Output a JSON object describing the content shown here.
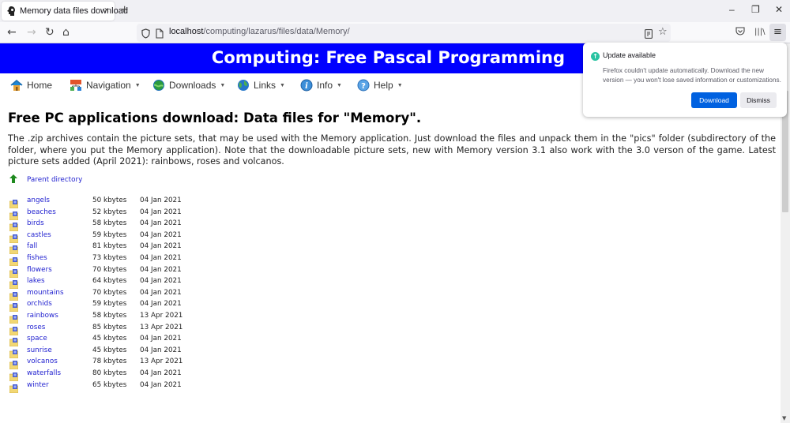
{
  "browser": {
    "tab": {
      "title": "Memory data files download",
      "close": "×"
    },
    "new_tab": "+",
    "window_controls": {
      "minimize": "–",
      "restore": "❐",
      "close": "✕"
    },
    "nav": {
      "back": "←",
      "forward": "→",
      "reload": "↻",
      "home": "⌂"
    },
    "url": {
      "host": "localhost",
      "path": "/computing/lazarus/files/data/Memory/"
    },
    "toolbar": {
      "bookmark": "☆",
      "pocket": "◡",
      "library": "|||\\",
      "menu": "≡"
    }
  },
  "page": {
    "banner_title": "Computing: Free Pascal Programming",
    "menu": [
      {
        "label": "Home",
        "icon": "home-icon",
        "dropdown": false
      },
      {
        "label": "Navigation",
        "icon": "navigation-icon",
        "dropdown": true
      },
      {
        "label": "Downloads",
        "icon": "downloads-icon",
        "dropdown": true
      },
      {
        "label": "Links",
        "icon": "globe-icon",
        "dropdown": true
      },
      {
        "label": "Info",
        "icon": "info-icon",
        "dropdown": true
      },
      {
        "label": "Help",
        "icon": "help-icon",
        "dropdown": true
      }
    ],
    "caret": "▼",
    "heading": "Free PC applications download: Data files for \"Memory\".",
    "intro": "The .zip archives contain the picture sets, that may be used with the Memory application. Just download the files and unpack them in the \"pics\" folder (subdirectory of the folder, where you put the Memory application). Note that the downloadable picture sets, new with Memory version 3.1 also work with the 3.0 verson of the game. Latest picture sets added (April 2021): rainbows, roses and volcanos.",
    "parent_directory": "Parent directory",
    "files": [
      {
        "name": "angels",
        "size": "50 kbytes",
        "date": "04 Jan 2021"
      },
      {
        "name": "beaches",
        "size": "52 kbytes",
        "date": "04 Jan 2021"
      },
      {
        "name": "birds",
        "size": "58 kbytes",
        "date": "04 Jan 2021"
      },
      {
        "name": "castles",
        "size": "59 kbytes",
        "date": "04 Jan 2021"
      },
      {
        "name": "fall",
        "size": "81 kbytes",
        "date": "04 Jan 2021"
      },
      {
        "name": "fishes",
        "size": "73 kbytes",
        "date": "04 Jan 2021"
      },
      {
        "name": "flowers",
        "size": "70 kbytes",
        "date": "04 Jan 2021"
      },
      {
        "name": "lakes",
        "size": "64 kbytes",
        "date": "04 Jan 2021"
      },
      {
        "name": "mountains",
        "size": "70 kbytes",
        "date": "04 Jan 2021"
      },
      {
        "name": "orchids",
        "size": "59 kbytes",
        "date": "04 Jan 2021"
      },
      {
        "name": "rainbows",
        "size": "58 kbytes",
        "date": "13 Apr 2021"
      },
      {
        "name": "roses",
        "size": "85 kbytes",
        "date": "13 Apr 2021"
      },
      {
        "name": "space",
        "size": "45 kbytes",
        "date": "04 Jan 2021"
      },
      {
        "name": "sunrise",
        "size": "45 kbytes",
        "date": "04 Jan 2021"
      },
      {
        "name": "volcanos",
        "size": "78 kbytes",
        "date": "13 Apr 2021"
      },
      {
        "name": "waterfalls",
        "size": "80 kbytes",
        "date": "04 Jan 2021"
      },
      {
        "name": "winter",
        "size": "65 kbytes",
        "date": "04 Jan 2021"
      }
    ]
  },
  "update_popup": {
    "title": "Update available",
    "message": "Firefox couldn't update automatically. Download the new version — you won't lose saved information or customizations.",
    "download_label": "Download",
    "dismiss_label": "Dismiss"
  },
  "colors": {
    "banner": "#0000ff",
    "link": "#2323d0",
    "primary_button": "#0061e0",
    "update_icon": "#2ac3a2"
  }
}
